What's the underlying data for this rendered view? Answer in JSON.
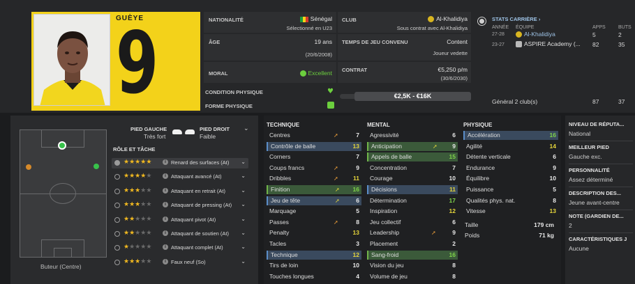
{
  "player": {
    "name": "GUÈYE",
    "number": "9",
    "nationality_label": "NATIONALITÉ",
    "nationality": "Sénégal",
    "nationality_sub": "Sélectionné en U23",
    "age_label": "ÂGE",
    "age": "19 ans",
    "birthdate": "(20/6/2008)",
    "morale_label": "MORAL",
    "morale": "Excellent",
    "condition_label": "CONDITION PHYSIQUE",
    "form_label": "FORME PHYSIQUE",
    "club_label": "CLUB",
    "club": "Al-Khalidiya",
    "club_sub": "Sous contrat avec Al-Khalidiya",
    "playtime_label": "TEMPS DE JEU CONVENU",
    "playtime": "Content",
    "playtime_sub": "Joueur vedette",
    "contract_label": "CONTRAT",
    "contract": "€5,250 p/m",
    "contract_end": "(30/6/2030)",
    "value_range": "€2,5K - €16K"
  },
  "career": {
    "title": "STATS CARRIÈRE",
    "col_year": "ANNÉE",
    "col_team": "ÉQUIPE",
    "col_apps": "APPS",
    "col_goals": "BUTS",
    "rows": [
      {
        "year": "27-28",
        "team": "Al-Khalidiya",
        "apps": "5",
        "goals": "2"
      },
      {
        "year": "23-27",
        "team": "ASPIRE Academy (...",
        "apps": "82",
        "goals": "35"
      }
    ],
    "total_label": "Général 2 club(s)",
    "total_apps": "87",
    "total_goals": "37"
  },
  "feet": {
    "left_label": "PIED GAUCHE",
    "left_value": "Très fort",
    "right_label": "PIED DROIT",
    "right_value": "Faible"
  },
  "pitch_caption": "Buteur (Centre)",
  "roles": {
    "title": "RÔLE ET TÂCHE",
    "items": [
      {
        "stars": 4.5,
        "name": "Renard des surfaces (At)",
        "selected": true
      },
      {
        "stars": 4,
        "name": "Attaquant avancé (At)",
        "selected": false
      },
      {
        "stars": 3,
        "name": "Attaquant en retrait (At)",
        "selected": false
      },
      {
        "stars": 3,
        "name": "Attaquant de pressing (At)",
        "selected": false
      },
      {
        "stars": 2,
        "name": "Attaquant pivot (At)",
        "selected": false
      },
      {
        "stars": 1.5,
        "name": "Attaquant de soutien (At)",
        "selected": false
      },
      {
        "stars": 1,
        "name": "Attaquant complet (At)",
        "selected": false
      },
      {
        "stars": 2.5,
        "name": "Faux neuf (So)",
        "selected": false
      }
    ]
  },
  "technique": {
    "title": "TECHNIQUE",
    "rows": [
      {
        "name": "Centres",
        "value": "7",
        "hl": "",
        "arrow": "up-orange"
      },
      {
        "name": "Contrôle de balle",
        "value": "13",
        "hl": "blue",
        "arrow": ""
      },
      {
        "name": "Corners",
        "value": "7",
        "hl": "",
        "arrow": ""
      },
      {
        "name": "Coups francs",
        "value": "9",
        "hl": "",
        "arrow": "up-orange"
      },
      {
        "name": "Dribbles",
        "value": "11",
        "hl": "",
        "arrow": "up-orange"
      },
      {
        "name": "Finition",
        "value": "16",
        "hl": "green",
        "arrow": "up-yellow"
      },
      {
        "name": "Jeu de tête",
        "value": "6",
        "hl": "blue",
        "arrow": "up-yellow"
      },
      {
        "name": "Marquage",
        "value": "5",
        "hl": "",
        "arrow": ""
      },
      {
        "name": "Passes",
        "value": "8",
        "hl": "",
        "arrow": "up-orange"
      },
      {
        "name": "Penalty",
        "value": "13",
        "hl": "",
        "arrow": ""
      },
      {
        "name": "Tacles",
        "value": "3",
        "hl": "",
        "arrow": ""
      },
      {
        "name": "Technique",
        "value": "12",
        "hl": "blue",
        "arrow": ""
      },
      {
        "name": "Tirs de loin",
        "value": "10",
        "hl": "",
        "arrow": ""
      },
      {
        "name": "Touches longues",
        "value": "4",
        "hl": "",
        "arrow": ""
      }
    ]
  },
  "mental": {
    "title": "MENTAL",
    "rows": [
      {
        "name": "Agressivité",
        "value": "6",
        "hl": "",
        "arrow": ""
      },
      {
        "name": "Anticipation",
        "value": "9",
        "hl": "green",
        "arrow": "up-yellow"
      },
      {
        "name": "Appels de balle",
        "value": "15",
        "hl": "green",
        "arrow": ""
      },
      {
        "name": "Concentration",
        "value": "7",
        "hl": "",
        "arrow": ""
      },
      {
        "name": "Courage",
        "value": "10",
        "hl": "",
        "arrow": ""
      },
      {
        "name": "Décisions",
        "value": "11",
        "hl": "blue",
        "arrow": ""
      },
      {
        "name": "Détermination",
        "value": "17",
        "hl": "",
        "arrow": ""
      },
      {
        "name": "Inspiration",
        "value": "12",
        "hl": "",
        "arrow": ""
      },
      {
        "name": "Jeu collectif",
        "value": "6",
        "hl": "",
        "arrow": ""
      },
      {
        "name": "Leadership",
        "value": "9",
        "hl": "",
        "arrow": "up-orange"
      },
      {
        "name": "Placement",
        "value": "2",
        "hl": "",
        "arrow": ""
      },
      {
        "name": "Sang-froid",
        "value": "16",
        "hl": "green",
        "arrow": ""
      },
      {
        "name": "Vision du jeu",
        "value": "8",
        "hl": "",
        "arrow": ""
      },
      {
        "name": "Volume de jeu",
        "value": "8",
        "hl": "",
        "arrow": ""
      }
    ]
  },
  "physique": {
    "title": "PHYSIQUE",
    "rows": [
      {
        "name": "Accélération",
        "value": "16",
        "hl": "blue",
        "arrow": ""
      },
      {
        "name": "Agilité",
        "value": "14",
        "hl": "",
        "arrow": ""
      },
      {
        "name": "Détente verticale",
        "value": "6",
        "hl": "",
        "arrow": ""
      },
      {
        "name": "Endurance",
        "value": "9",
        "hl": "",
        "arrow": ""
      },
      {
        "name": "Équilibre",
        "value": "10",
        "hl": "",
        "arrow": ""
      },
      {
        "name": "Puissance",
        "value": "5",
        "hl": "",
        "arrow": ""
      },
      {
        "name": "Qualités phys. nat.",
        "value": "8",
        "hl": "",
        "arrow": ""
      },
      {
        "name": "Vitesse",
        "value": "13",
        "hl": "",
        "arrow": ""
      }
    ],
    "height_label": "Taille",
    "height": "179 cm",
    "weight_label": "Poids",
    "weight": "71 kg"
  },
  "right_info": [
    {
      "label": "NIVEAU DE RÉPUTA...",
      "value": "National"
    },
    {
      "label": "MEILLEUR PIED",
      "value": "Gauche exc."
    },
    {
      "label": "PERSONNALITÉ",
      "value": "Assez déterminé"
    },
    {
      "label": "DESCRIPTION DES...",
      "value": "Jeune avant-centre"
    },
    {
      "label": "NOTE (GARDIEN DE...",
      "value": "2"
    },
    {
      "label": "CARACTÉRISTIQUES J",
      "value": "Aucune"
    }
  ],
  "colors": {
    "accent_yellow": "#f3d21a",
    "good_green": "#6ccf3e",
    "highlight_blue": "#3a4a5e",
    "highlight_green": "#3b5a3a"
  }
}
